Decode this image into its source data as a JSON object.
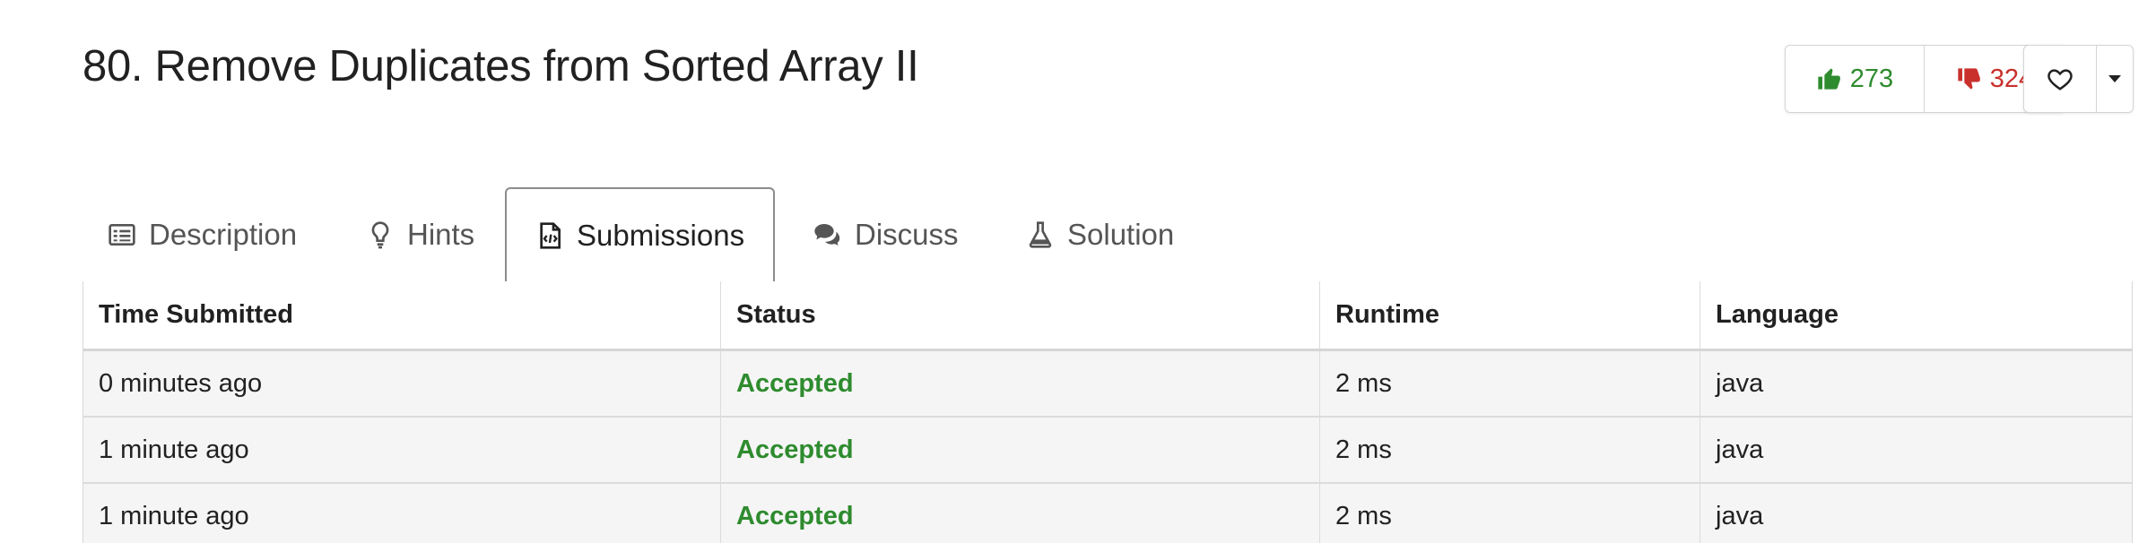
{
  "problem": {
    "title": "80. Remove Duplicates from Sorted Array II"
  },
  "votes": {
    "likes": "273",
    "dislikes": "324"
  },
  "tabs": [
    {
      "label": "Description",
      "icon": "description-icon"
    },
    {
      "label": "Hints",
      "icon": "lightbulb-icon"
    },
    {
      "label": "Submissions",
      "icon": "code-file-icon"
    },
    {
      "label": "Discuss",
      "icon": "chat-bubbles-icon"
    },
    {
      "label": "Solution",
      "icon": "flask-icon"
    }
  ],
  "active_tab": "Submissions",
  "table": {
    "headers": [
      "Time Submitted",
      "Status",
      "Runtime",
      "Language"
    ],
    "rows": [
      {
        "time": "0 minutes ago",
        "status": "Accepted",
        "runtime": "2 ms",
        "language": "java"
      },
      {
        "time": "1 minute ago",
        "status": "Accepted",
        "runtime": "2 ms",
        "language": "java"
      },
      {
        "time": "1 minute ago",
        "status": "Accepted",
        "runtime": "2 ms",
        "language": "java"
      }
    ]
  },
  "colors": {
    "accepted": "#2e8b2e",
    "like": "#2e8b2e",
    "dislike": "#c9302c"
  }
}
